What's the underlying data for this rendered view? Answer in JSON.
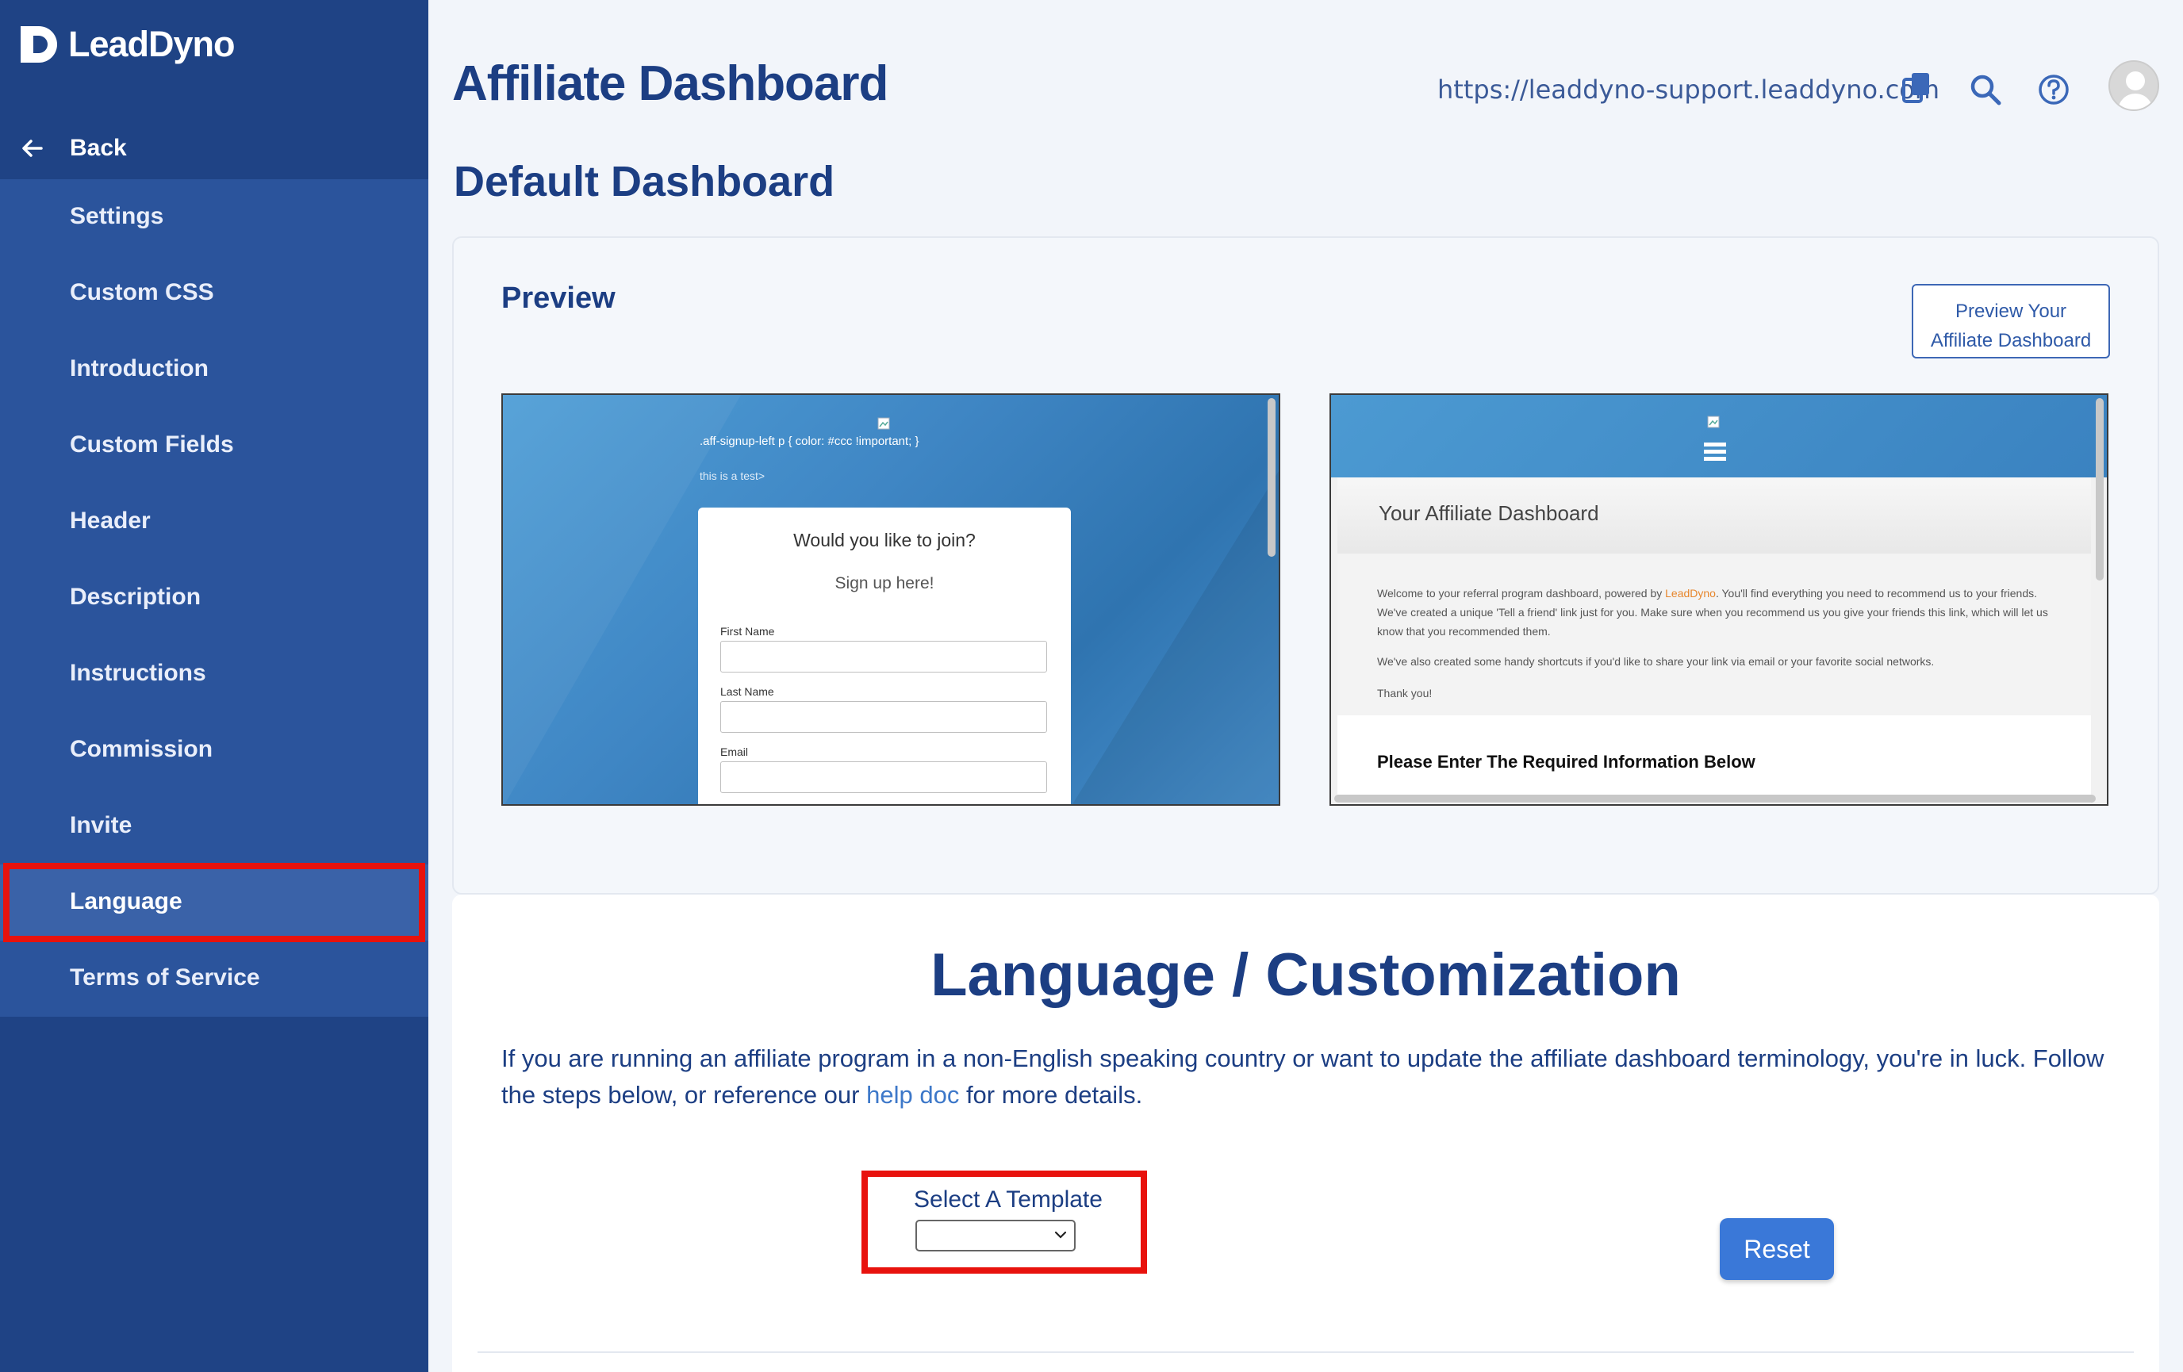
{
  "brand": {
    "name": "LeadDyno"
  },
  "sidebar": {
    "back_label": "Back",
    "items": [
      {
        "label": "Settings"
      },
      {
        "label": "Custom CSS"
      },
      {
        "label": "Introduction"
      },
      {
        "label": "Custom Fields"
      },
      {
        "label": "Header"
      },
      {
        "label": "Description"
      },
      {
        "label": "Instructions"
      },
      {
        "label": "Commission"
      },
      {
        "label": "Invite"
      },
      {
        "label": "Language",
        "active": true
      },
      {
        "label": "Terms of Service"
      }
    ]
  },
  "header": {
    "title": "Affiliate Dashboard",
    "url": "https://leaddyno-support.leaddyno.com",
    "icons": [
      "copy-icon",
      "search-icon",
      "help-icon",
      "avatar"
    ]
  },
  "subtitle": "Default Dashboard",
  "preview": {
    "label": "Preview",
    "button_line1": "Preview Your",
    "button_line2": "Affiliate Dashboard",
    "signup": {
      "css_text": ".aff-signup-left p { color: #ccc !important; }",
      "test_text": "this is a test>",
      "question": "Would you like to join?",
      "subheading": "Sign up here!",
      "fields": [
        "First Name",
        "Last Name",
        "Email"
      ]
    },
    "dashboard": {
      "title": "Your Affiliate Dashboard",
      "welcome_before": "Welcome to your referral program dashboard, powered by ",
      "welcome_link": "LeadDyno",
      "welcome_after": ". You'll find everything you need to recommend us to your friends. We've created a unique 'Tell a friend' link just for you. Make sure when you recommend us you give your friends this link, which will let us know that you recommended them.",
      "shortcuts": "We've also created some handy shortcuts if you'd like to share your link via email or your favorite social networks.",
      "thanks": "Thank you!",
      "required": "Please Enter The Required Information Below"
    }
  },
  "language": {
    "title": "Language / Customization",
    "desc_before": "If you are running an affiliate program in a non-English speaking country or want to update the affiliate dashboard terminology, you're in luck. Follow the steps below, or reference our ",
    "desc_link": "help doc",
    "desc_after": " for more details.",
    "template_label": "Select A Template",
    "template_value": "",
    "reset_label": "Reset"
  },
  "colors": {
    "sidebar_bg": "#1f4385",
    "menu_bg": "#2b549c",
    "accent": "#3a78d8",
    "highlight": "#e8120d",
    "title": "#1c3e83"
  }
}
